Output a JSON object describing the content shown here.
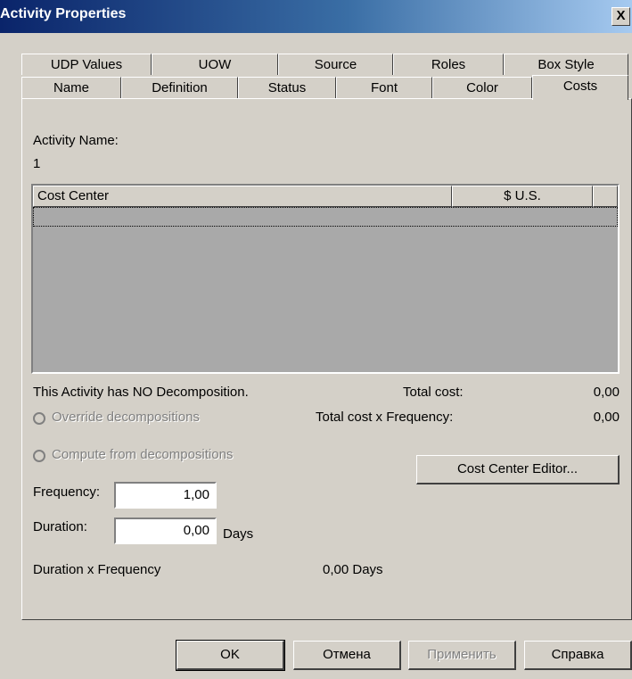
{
  "window": {
    "title": "Activity Properties",
    "close_label": "X"
  },
  "tabs_row1": [
    "UDP Values",
    "UOW",
    "Source",
    "Roles",
    "Box Style"
  ],
  "tabs_row2": [
    "Name",
    "Definition",
    "Status",
    "Font",
    "Color",
    "Costs"
  ],
  "activity": {
    "name_label": "Activity Name:",
    "name_value": "1"
  },
  "grid": {
    "columns": [
      "Cost Center",
      "$ U.S."
    ]
  },
  "decomposition_text": "This Activity has NO Decomposition.",
  "options": {
    "override": "Override decompositions",
    "compute": "Compute from decompositions"
  },
  "totals": {
    "total_cost_label": "Total cost:",
    "total_cost_value": "0,00",
    "total_freq_label": "Total cost x Frequency:",
    "total_freq_value": "0,00"
  },
  "cost_center_editor_label": "Cost Center Editor...",
  "frequency": {
    "label": "Frequency:",
    "value": "1,00"
  },
  "duration": {
    "label": "Duration:",
    "value": "0,00",
    "unit": "Days"
  },
  "duration_freq": {
    "label": "Duration x Frequency",
    "value": "0,00 Days"
  },
  "buttons": {
    "ok": "OK",
    "cancel": "Отмена",
    "apply": "Применить",
    "help": "Справка"
  }
}
